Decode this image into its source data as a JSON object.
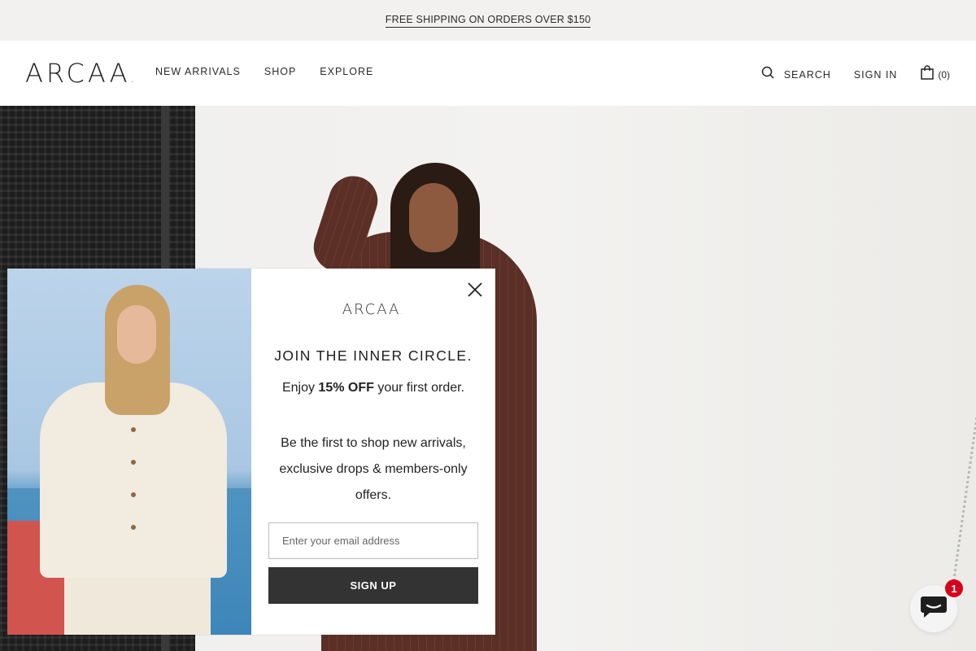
{
  "announcement": {
    "text": "FREE SHIPPING ON ORDERS OVER $150"
  },
  "header": {
    "logo": "ARCAA",
    "logo_dot": ".",
    "nav": [
      {
        "label": "NEW ARRIVALS"
      },
      {
        "label": "SHOP"
      },
      {
        "label": "EXPLORE"
      }
    ],
    "search_label": "SEARCH",
    "signin_label": "SIGN IN",
    "cart_count": "(0)"
  },
  "modal": {
    "logo": "ARCAA",
    "logo_dot": ".",
    "heading": "JOIN THE INNER CIRCLE.",
    "offer_prefix": "Enjoy ",
    "offer_bold": "15% OFF",
    "offer_suffix": " your first order.",
    "description": "Be the first to shop new arrivals, exclusive drops & members-only offers.",
    "email_placeholder": "Enter your email address",
    "email_value": "",
    "signup_label": "SIGN UP"
  },
  "chat": {
    "badge_count": "1"
  },
  "icons": {
    "search": "search-icon",
    "cart": "shopping-bag-icon",
    "close": "close-icon",
    "chat": "chat-bubble-icon"
  },
  "colors": {
    "announcement_bg": "#f2f1ef",
    "signup_button": "#333333",
    "chat_badge": "#d6001c"
  }
}
